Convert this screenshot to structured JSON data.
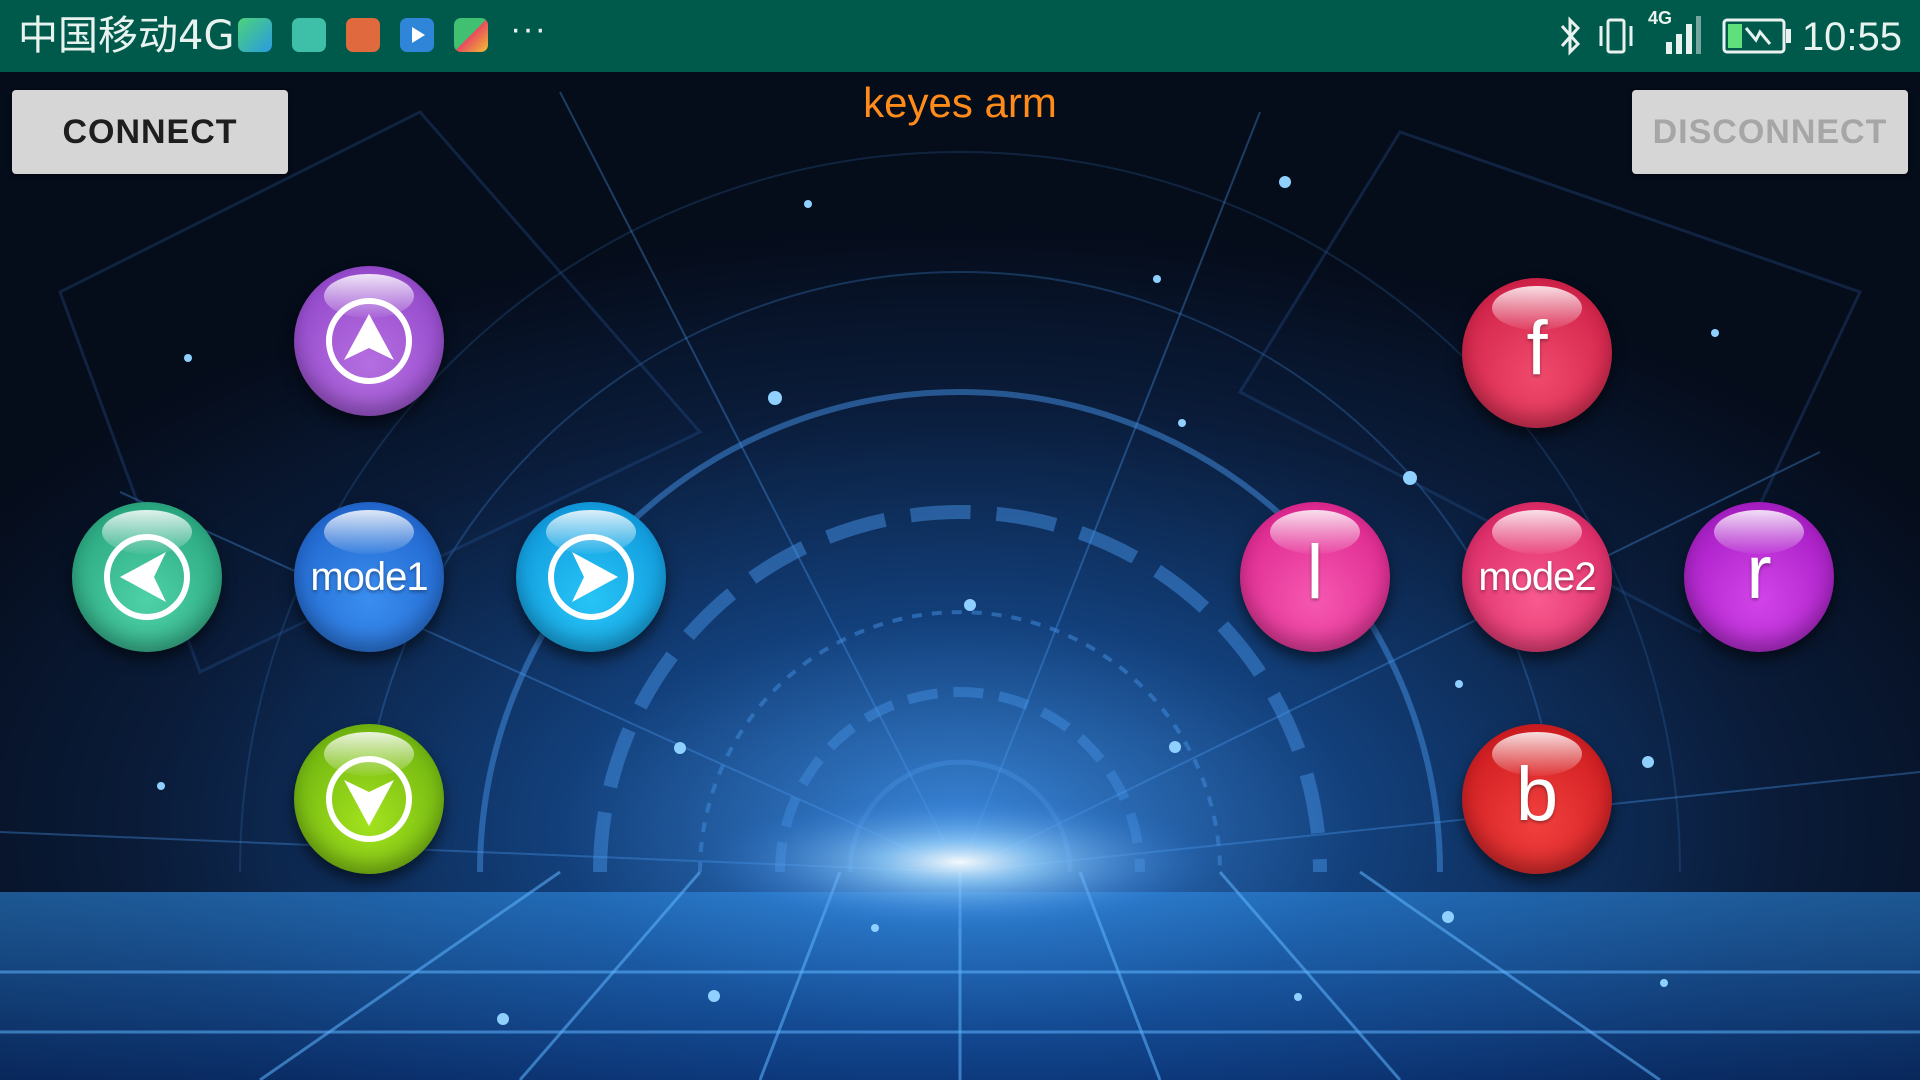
{
  "status_bar": {
    "carrier": "中国移动4G",
    "overflow": "···",
    "network_type": "4G",
    "time": "10:55",
    "app_icons": [
      "maps-icon",
      "android-icon",
      "phone-app-icon",
      "video-player-icon",
      "play-store-icon"
    ]
  },
  "app": {
    "title": "keyes arm",
    "title_color": "#ff8c1a",
    "connect_label": "CONNECT",
    "disconnect_label": "DISCONNECT"
  },
  "controls": {
    "left_pad": {
      "up": {
        "icon": "arrow-up-icon"
      },
      "left": {
        "icon": "arrow-left-icon"
      },
      "center": {
        "label": "mode1"
      },
      "right": {
        "icon": "arrow-right-icon"
      },
      "down": {
        "icon": "arrow-down-icon"
      }
    },
    "right_pad": {
      "forward": {
        "label": "f"
      },
      "left": {
        "label": "l"
      },
      "center": {
        "label": "mode2"
      },
      "right": {
        "label": "r"
      },
      "back": {
        "label": "b"
      }
    }
  },
  "colors": {
    "status_bar": "#005a4c",
    "up": "#b56ee0",
    "left": "#3cc49a",
    "mode1": "#2f7fe8",
    "right_arrow": "#19b6ee",
    "down": "#8fd61e",
    "f": "#e8345e",
    "l": "#f0389b",
    "mode2": "#f43a7c",
    "r": "#c32ad9",
    "b": "#e8282f"
  }
}
